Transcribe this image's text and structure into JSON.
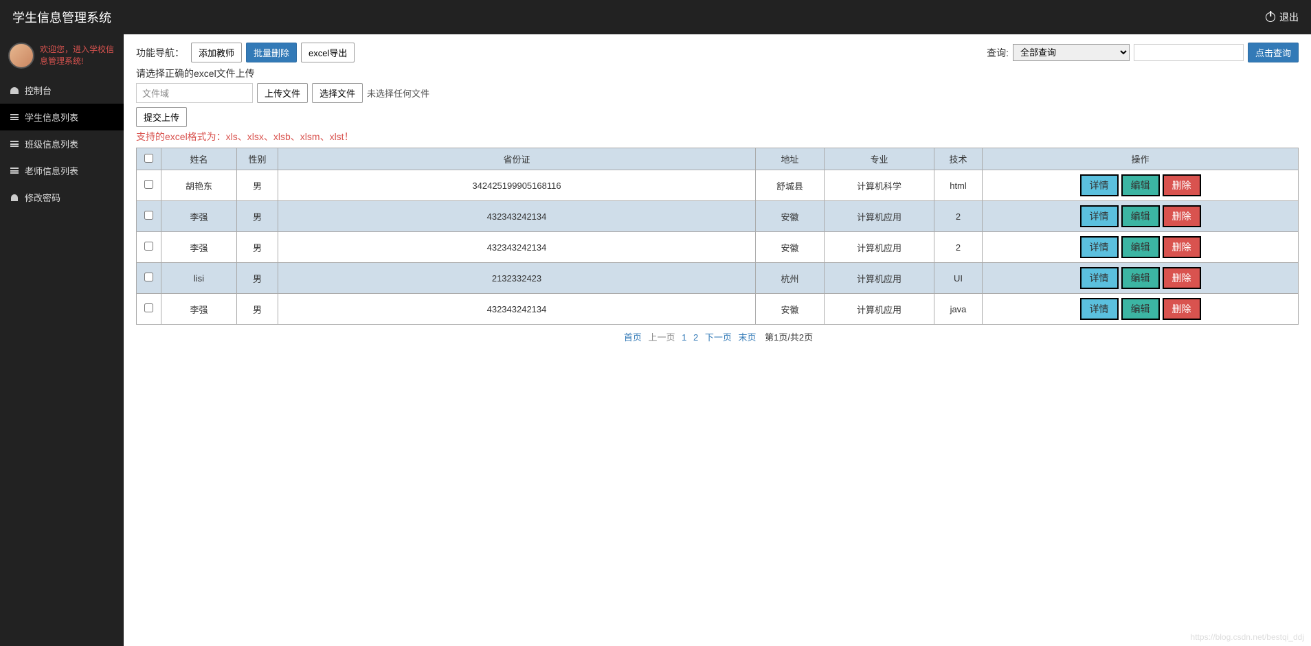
{
  "header": {
    "title": "学生信息管理系统",
    "logout": "退出"
  },
  "sidebar": {
    "welcome": "欢迎您，进入学校信息管理系统!",
    "items": [
      {
        "label": "控制台",
        "icon": "dashboard"
      },
      {
        "label": "学生信息列表",
        "icon": "list"
      },
      {
        "label": "班级信息列表",
        "icon": "list"
      },
      {
        "label": "老师信息列表",
        "icon": "list"
      },
      {
        "label": "修改密码",
        "icon": "user"
      }
    ]
  },
  "toolbar": {
    "nav_label": "功能导航：",
    "add_teacher": "添加教师",
    "batch_delete": "批量删除",
    "excel_export": "excel导出",
    "query_label": "查询:",
    "query_select_default": "全部查询",
    "query_button": "点击查询"
  },
  "upload": {
    "hint": "请选择正确的excel文件上传",
    "file_domain_placeholder": "文件域",
    "upload_file_btn": "上传文件",
    "choose_file_btn": "选择文件",
    "no_file_text": "未选择任何文件",
    "submit_btn": "提交上传",
    "format_hint": "支持的excel格式为：xls、xlsx、xlsb、xlsm、xlst！"
  },
  "table": {
    "headers": [
      "",
      "姓名",
      "性别",
      "省份证",
      "地址",
      "专业",
      "技术",
      "操作"
    ],
    "actions": {
      "detail": "详情",
      "edit": "编辑",
      "delete": "删除"
    },
    "rows": [
      {
        "name": "胡艳东",
        "gender": "男",
        "id": "342425199905168116",
        "address": "舒城县",
        "major": "计算机科学",
        "tech": "html"
      },
      {
        "name": "李强",
        "gender": "男",
        "id": "432343242134",
        "address": "安徽",
        "major": "计算机应用",
        "tech": "2"
      },
      {
        "name": "李强",
        "gender": "男",
        "id": "432343242134",
        "address": "安徽",
        "major": "计算机应用",
        "tech": "2"
      },
      {
        "name": "lisi",
        "gender": "男",
        "id": "2132332423",
        "address": "杭州",
        "major": "计算机应用",
        "tech": "UI"
      },
      {
        "name": "李强",
        "gender": "男",
        "id": "432343242134",
        "address": "安徽",
        "major": "计算机应用",
        "tech": "java"
      }
    ]
  },
  "pagination": {
    "first": "首页",
    "prev": "上一页",
    "pages": [
      "1",
      "2"
    ],
    "next": "下一页",
    "last": "末页",
    "info": "第1页/共2页"
  },
  "watermark": "https://blog.csdn.net/bestqi_ddj"
}
